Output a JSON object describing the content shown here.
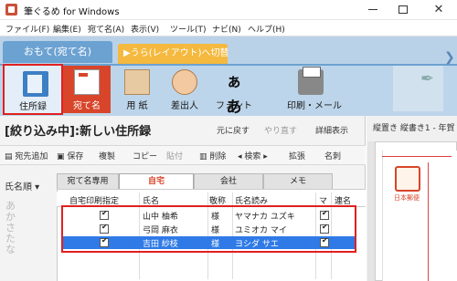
{
  "window": {
    "title": "筆ぐるめ for Windows"
  },
  "menu": [
    "ファイル(F)",
    "編集(E)",
    "宛て名(A)",
    "表示(V)",
    "ツール(T)",
    "ナビ(N)",
    "ヘルプ(H)"
  ],
  "ribbon": {
    "tab_front": "おもて(宛て名)",
    "tab_back": "▶うら(レイアウト)へ切替",
    "buttons": [
      {
        "label": "住所録",
        "icon": "address-book-icon"
      },
      {
        "label": "宛て名",
        "icon": "name-card-icon"
      },
      {
        "label": "用 紙",
        "icon": "paper-icon"
      },
      {
        "label": "差出人",
        "icon": "sender-icon"
      },
      {
        "label": "フォント",
        "icon": "font-icon",
        "glyph": "ぁあ"
      },
      {
        "label": "印刷・メール",
        "icon": "printer-icon"
      }
    ]
  },
  "list_header": {
    "title": "[絞り込み中]:新しい住所録",
    "undo": "元に戻す",
    "redo": "やり直す",
    "details": "詳細表示"
  },
  "toolbar": {
    "add": "宛先追加",
    "save": "保存",
    "copy": "複製",
    "copy2": "コピー",
    "paste": "貼付",
    "delete": "削除",
    "search": "検索",
    "extend": "拡張",
    "card": "名刺"
  },
  "sidebar": {
    "sort_label": "氏名順",
    "kana": "あかさたな"
  },
  "tabs": [
    "宛て名専用",
    "自宅",
    "会社",
    "メモ"
  ],
  "columns": [
    "自宅印刷指定",
    "氏名",
    "敬称",
    "氏名読み",
    "マ",
    "連名"
  ],
  "rows": [
    {
      "name": "山中 柚希",
      "honorific": "様",
      "reading": "ヤマナカ ユズキ",
      "checked": true,
      "selected": false
    },
    {
      "name": "弓岡 麻衣",
      "honorific": "様",
      "reading": "ユミオカ マイ",
      "checked": true,
      "selected": false
    },
    {
      "name": "吉田 紗枝",
      "honorific": "様",
      "reading": "ヨシダ サエ",
      "checked": true,
      "selected": true
    }
  ],
  "preview": {
    "label": "縦置き 縦書き1 - 年賀",
    "stamp_label": "日本郵便"
  }
}
